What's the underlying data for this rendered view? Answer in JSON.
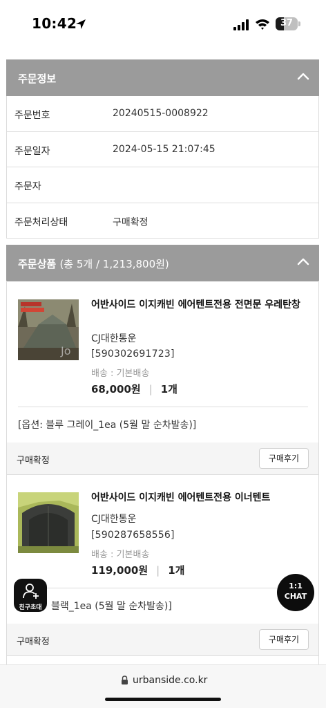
{
  "status_bar": {
    "time": "10:42",
    "battery": "37",
    "battery_level": 0.37
  },
  "order_info": {
    "header": "주문정보",
    "rows": [
      {
        "label": "주문번호",
        "value": "20240515-0008922"
      },
      {
        "label": "주문일자",
        "value": "2024-05-15 21:07:45"
      },
      {
        "label": "주문자",
        "value": ""
      },
      {
        "label": "주문처리상태",
        "value": "구매확정"
      }
    ]
  },
  "order_products": {
    "header": "주문상품",
    "summary": "(총 5개 / 1,213,800원)",
    "items": [
      {
        "name": "어반사이드 이지캐빈 에어텐트전용 전면문 우레탄창",
        "courier": "CJ대한통운",
        "tracking": "[590302691723]",
        "shipping": "배송 : 기본배송",
        "price": "68,000원",
        "separator": "|",
        "qty": "1개",
        "option": "[옵션: 블루 그레이_1ea (5월 말 순차발송)]",
        "status": "구매확정",
        "review_label": "구매후기"
      },
      {
        "name": "어반사이드 이지캐빈 에어텐트전용 이너텐트",
        "courier": "CJ대한통운",
        "tracking": "[590287658556]",
        "shipping": "배송 : 기본배송",
        "price": "119,000원",
        "separator": "|",
        "qty": "1개",
        "option": "블랙_1ea (5월 말 순차발송)]",
        "status": "구매확정",
        "review_label": "구매후기"
      }
    ]
  },
  "floating": {
    "invite_label": "친구초대",
    "chat_line1": "1:1",
    "chat_line2": "CHAT"
  },
  "browser": {
    "url": "urbanside.co.kr"
  },
  "colors": {
    "header_bg": "#9b9b9b",
    "border": "#dcdcdc",
    "strip_bg": "#f5f5f5"
  }
}
